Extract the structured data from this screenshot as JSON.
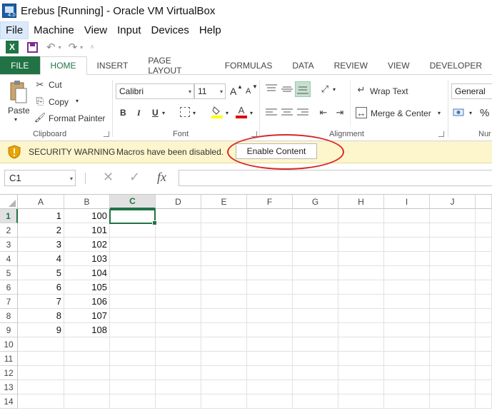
{
  "vbox": {
    "title": "Erebus [Running] - Oracle VM VirtualBox",
    "menu": [
      "File",
      "Machine",
      "View",
      "Input",
      "Devices",
      "Help"
    ]
  },
  "ribbon": {
    "tabs": [
      "FILE",
      "HOME",
      "INSERT",
      "PAGE LAYOUT",
      "FORMULAS",
      "DATA",
      "REVIEW",
      "VIEW",
      "DEVELOPER"
    ],
    "active_tab": "HOME",
    "clipboard": {
      "paste": "Paste",
      "cut": "Cut",
      "copy": "Copy",
      "format_painter": "Format Painter",
      "label": "Clipboard"
    },
    "font": {
      "name": "Calibri",
      "size": "11",
      "label": "Font",
      "bold": "B",
      "italic": "I",
      "underline": "U",
      "grow": "A",
      "shrink": "A",
      "font_color": "A"
    },
    "alignment": {
      "wrap_text": "Wrap Text",
      "merge_center": "Merge & Center",
      "label": "Alignment"
    },
    "number": {
      "format": "General",
      "percent": "%",
      "label": "Nur"
    }
  },
  "security": {
    "title": "SECURITY WARNING",
    "message": "Macros have been disabled.",
    "button": "Enable Content"
  },
  "formula_bar": {
    "name_box": "C1",
    "fx": "fx",
    "value": ""
  },
  "sheet": {
    "columns": [
      "A",
      "B",
      "C",
      "D",
      "E",
      "F",
      "G",
      "H",
      "I",
      "J"
    ],
    "selected_column": "C",
    "selected_row": "1",
    "rows": [
      {
        "num": "1",
        "a": "1",
        "b": "100"
      },
      {
        "num": "2",
        "a": "2",
        "b": "101"
      },
      {
        "num": "3",
        "a": "3",
        "b": "102"
      },
      {
        "num": "4",
        "a": "4",
        "b": "103"
      },
      {
        "num": "5",
        "a": "5",
        "b": "104"
      },
      {
        "num": "6",
        "a": "6",
        "b": "105"
      },
      {
        "num": "7",
        "a": "7",
        "b": "106"
      },
      {
        "num": "8",
        "a": "8",
        "b": "107"
      },
      {
        "num": "9",
        "a": "9",
        "b": "108"
      },
      {
        "num": "10",
        "a": "",
        "b": ""
      },
      {
        "num": "11",
        "a": "",
        "b": ""
      },
      {
        "num": "12",
        "a": "",
        "b": ""
      },
      {
        "num": "13",
        "a": "",
        "b": ""
      },
      {
        "num": "14",
        "a": "",
        "b": ""
      }
    ]
  },
  "colors": {
    "excel_green": "#217346",
    "warning_bg": "#fdf5cc",
    "annotation_red": "#d62828"
  }
}
